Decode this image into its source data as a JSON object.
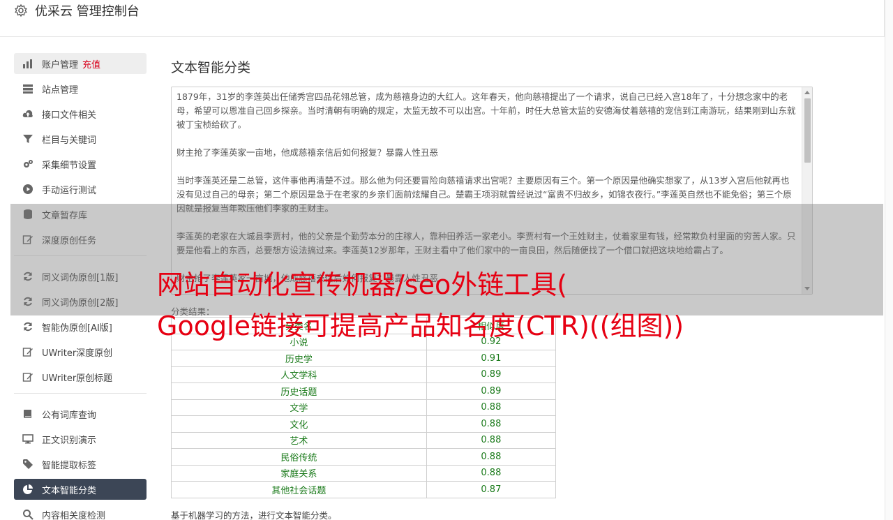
{
  "app": {
    "title": "优采云 管理控制台"
  },
  "sidebar": {
    "group1": [
      {
        "label": "账户管理",
        "tag": "充值",
        "icon": "bar-chart-icon",
        "name": "sidebar-item-account"
      },
      {
        "label": "站点管理",
        "icon": "server-icon",
        "name": "sidebar-item-sites"
      },
      {
        "label": "接口文件相关",
        "icon": "cloud-upload-icon",
        "name": "sidebar-item-interface"
      },
      {
        "label": "栏目与关键词",
        "icon": "filter-icon",
        "name": "sidebar-item-columns"
      },
      {
        "label": "采集细节设置",
        "icon": "cogs-icon",
        "name": "sidebar-item-collect-settings"
      },
      {
        "label": "手动运行测试",
        "icon": "play-circle-icon",
        "name": "sidebar-item-manual-run"
      },
      {
        "label": "文章暂存库",
        "icon": "database-icon",
        "name": "sidebar-item-article-store"
      },
      {
        "label": "深度原创任务",
        "icon": "edit-icon",
        "name": "sidebar-item-deep-original"
      }
    ],
    "group2": [
      {
        "label": "同义词伪原创[1版]",
        "icon": "refresh-icon",
        "name": "sidebar-item-synonym-v1"
      },
      {
        "label": "同义词伪原创[2版]",
        "icon": "refresh-icon",
        "name": "sidebar-item-synonym-v2"
      },
      {
        "label": "智能伪原创[AI版]",
        "icon": "refresh-icon",
        "name": "sidebar-item-ai-rewrite"
      },
      {
        "label": "UWriter深度原创",
        "icon": "edit-icon",
        "name": "sidebar-item-uwriter-deep"
      },
      {
        "label": "UWriter原创标题",
        "icon": "edit-icon",
        "name": "sidebar-item-uwriter-title"
      }
    ],
    "group3": [
      {
        "label": "公有词库查询",
        "icon": "book-icon",
        "name": "sidebar-item-public-lexicon"
      },
      {
        "label": "正文识别演示",
        "icon": "desktop-icon",
        "name": "sidebar-item-text-recognition"
      },
      {
        "label": "智能提取标签",
        "icon": "tag-icon",
        "name": "sidebar-item-tag-extract"
      },
      {
        "label": "文本智能分类",
        "icon": "pie-chart-icon",
        "name": "sidebar-item-text-classify"
      },
      {
        "label": "内容相关度检测",
        "icon": "search-icon",
        "name": "sidebar-item-relevance"
      }
    ]
  },
  "main": {
    "title": "文本智能分类",
    "text_paragraphs": [
      "1879年，31岁的李莲英出任储秀宫四品花翎总管，成为慈禧身边的大红人。这年春天，他向慈禧提出了一个请求，说自己已经入宫18年了，十分想念家中的老母，希望可以恩准自己回乡探亲。当时清朝有明确的规定，太监无故不可以出宫。十年前，时任大总管太监的安德海仗着慈禧的宠信到江南游玩，结果刚到山东就被丁宝桢给砍了。",
      "财主抢了李莲英家一亩地，他成慈禧亲信后如何报复？暴露人性丑恶",
      "当时李莲英还是二总管，这件事他再清楚不过。那么他为何还要冒险向慈禧请求出宫呢？主要原因有三个。第一个原因是他确实想家了，从13岁入宫后他就再也没有见过自己的母亲；第二个原因是急于在老家的乡亲们面前炫耀自己。楚霸王项羽就曾经说过“富贵不归故乡，如锦衣夜行。”李莲英自然也不能免俗；第三个原因就是报复当年欺压他们李家的王财主。",
      "李莲英的老家在大城县李贾村，他的父亲是个勤劳本分的庄稼人，靠种田养活一家老小。李贾村有一个王姓财主，仗着家里有钱，经常欺负村里面的穷苦人家。只要是他看上的东西，总要想方设法搞过来。李莲英12岁那年，王财主看中了他们家中的一亩良田，然后随便找了一个借口就把这块地给霸占了。",
      "财主抢了李莲英家一亩地，他成慈禧亲信后如何报复？暴露人性丑恶"
    ],
    "result_label": "分类结果：",
    "table_headers": [
      "分类名",
      "相似度"
    ],
    "table_rows": [
      [
        "小说",
        "0.92"
      ],
      [
        "历史学",
        "0.91"
      ],
      [
        "人文学科",
        "0.89"
      ],
      [
        "历史话题",
        "0.89"
      ],
      [
        "文学",
        "0.88"
      ],
      [
        "文化",
        "0.88"
      ],
      [
        "艺术",
        "0.88"
      ],
      [
        "民俗传统",
        "0.88"
      ],
      [
        "家庭关系",
        "0.88"
      ],
      [
        "其他社会话题",
        "0.87"
      ]
    ],
    "description": "基于机器学习的方法，进行文本智能分类。"
  },
  "overlay": {
    "line1": "网站自动化宣传机器/seo外链工具(",
    "line2": "Google链接可提高产品知名度(CTR)((组图))"
  },
  "colors": {
    "accent_red": "#e60012",
    "active_nav": "#3c4656",
    "result_green": "#1a7a1a"
  }
}
